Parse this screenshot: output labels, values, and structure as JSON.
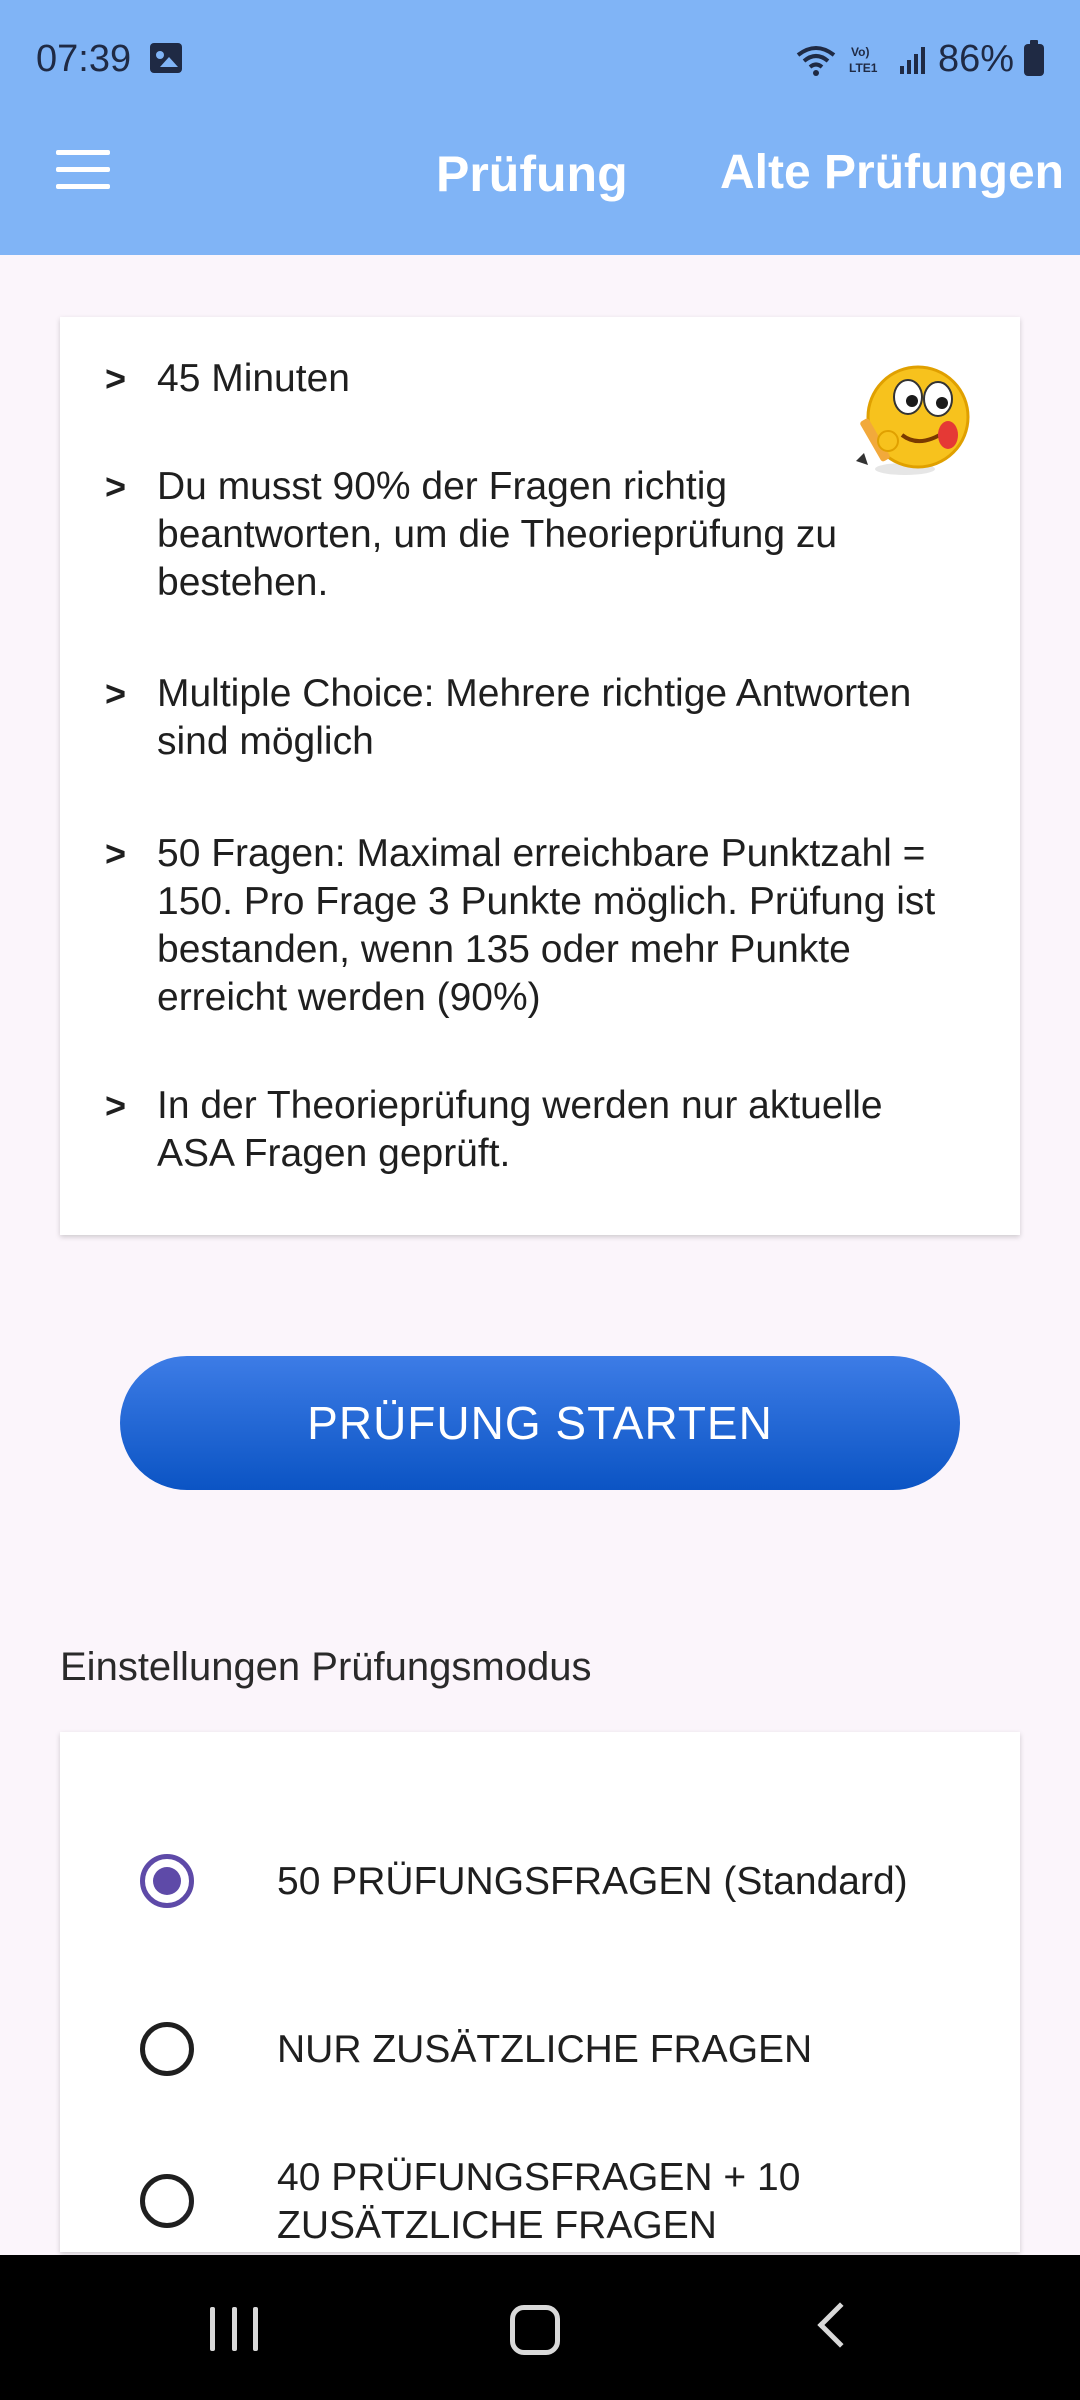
{
  "status_bar": {
    "time": "07:39",
    "battery": "86%",
    "network": "LTE1",
    "icons": [
      "gallery-icon",
      "wifi-icon",
      "volte-icon",
      "signal-icon",
      "battery-icon"
    ]
  },
  "app_bar": {
    "title": "Prüfung",
    "alt_link": "Alte Prüfungen",
    "menu_icon": "hamburger-menu-icon"
  },
  "info_card": {
    "bullets": [
      {
        "marker": ">",
        "text": "45 Minuten"
      },
      {
        "marker": ">",
        "text": "Du musst 90% der Fragen richtig beantworten, um die Theorieprüfung zu bestehen."
      },
      {
        "marker": ">",
        "text": "Multiple Choice: Mehrere richtige Antworten sind möglich"
      },
      {
        "marker": ">",
        "text": "50 Fragen: Maximal erreichbare Punktzahl = 150. Pro Frage 3 Punkte möglich. Prüfung ist bestanden, wenn 135 oder mehr Punkte erreicht werden (90%)"
      },
      {
        "marker": ">",
        "text": "In der Theorieprüfung werden nur aktuelle ASA Fragen geprüft."
      }
    ],
    "emoji_icon": "thinking-emoji-icon"
  },
  "start_button": {
    "label": "PRÜFUNG STARTEN",
    "color": "#0b54c4"
  },
  "settings": {
    "title": "Einstellungen Prüfungsmodus",
    "options": [
      {
        "label": "50 PRÜFUNGSFRAGEN (Standard)",
        "selected": true
      },
      {
        "label": "NUR ZUSÄTZLICHE FRAGEN",
        "selected": false
      },
      {
        "label": "40 PRÜFUNGSFRAGEN + 10 ZUSÄTZLICHE FRAGEN",
        "selected": false
      }
    ],
    "accent": "#5e4aa8"
  },
  "nav_bar": {
    "icons": [
      "recent-apps-icon",
      "home-icon",
      "back-icon"
    ]
  },
  "colors": {
    "app_bar": "#80b4f6",
    "background": "#fbf5fb"
  }
}
